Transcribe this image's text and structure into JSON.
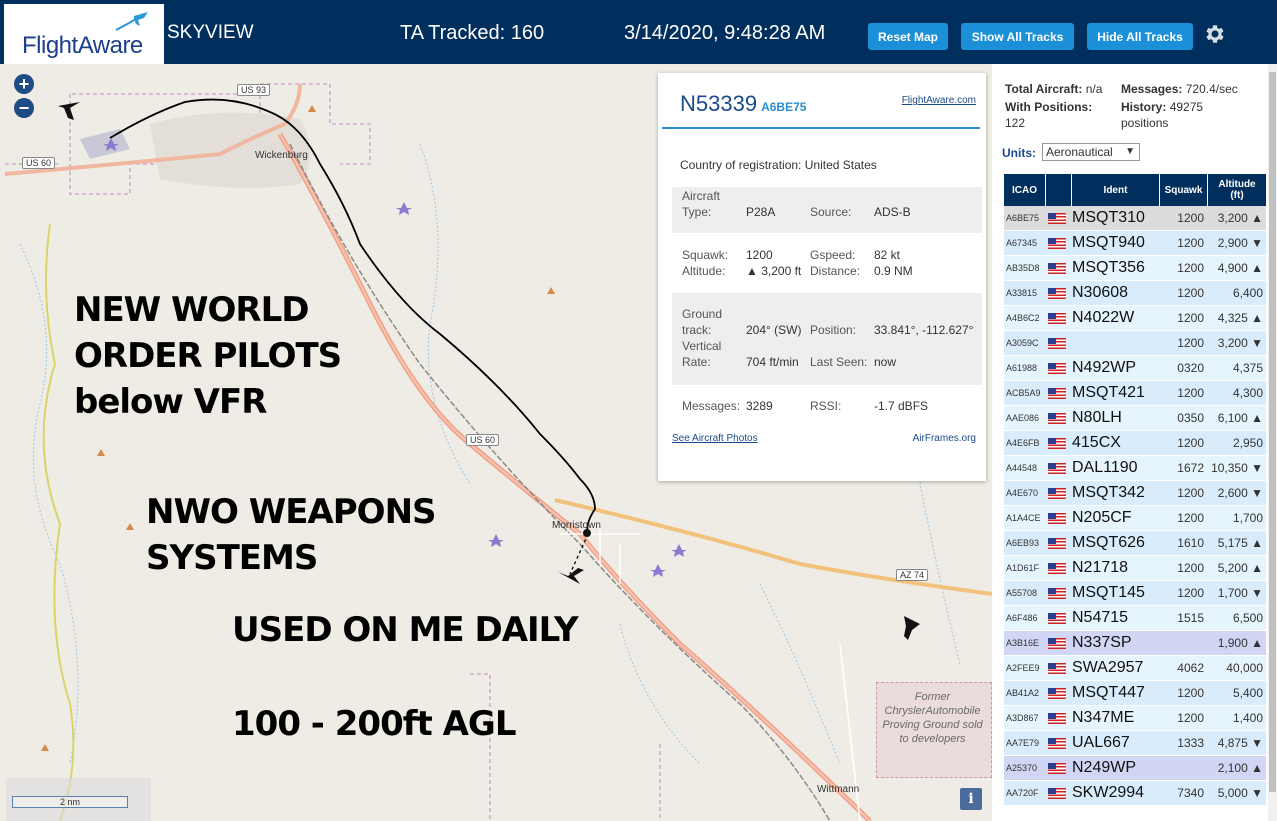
{
  "header": {
    "logo": "FlightAware",
    "app_name": "SKYVIEW",
    "tracked": "TA Tracked: 160",
    "datetime": "3/14/2020, 9:48:28 AM",
    "buttons": {
      "reset": "Reset Map",
      "show_all": "Show All Tracks",
      "hide_all": "Hide All Tracks"
    },
    "settings_icon": "gear-icon"
  },
  "map": {
    "zoom_in": "+",
    "zoom_out": "−",
    "scale": "2 nm",
    "info": "i",
    "labels": {
      "wickenburg": "Wickenburg",
      "morristown": "Morristown",
      "wittmann": "Wittmann",
      "us93": "US 93",
      "us60_a": "US 60",
      "us60_b": "US 60",
      "az74": "AZ 74",
      "chrysler": "Former ChryslerAutomobile Proving Ground sold to developers"
    },
    "overlay": {
      "line1": "NEW WORLD",
      "line2": "ORDER PILOTS",
      "line3": "below VFR",
      "line4": "NWO WEAPONS",
      "line5": "SYSTEMS",
      "line6": "USED ON ME DAILY",
      "line7": "100 - 200ft AGL"
    }
  },
  "popup": {
    "callsign": "N53339",
    "hex": "A6BE75",
    "fa_link": "FlightAware.com",
    "country_label": "Country of registration:",
    "country_value": "United States",
    "aircraft_type_label_1": "Aircraft",
    "aircraft_type_label_2": "Type:",
    "aircraft_type": "P28A",
    "source_label": "Source:",
    "source": "ADS-B",
    "squawk_label": "Squawk:",
    "squawk": "1200",
    "gspeed_label": "Gspeed:",
    "gspeed": "82 kt",
    "altitude_label": "Altitude:",
    "altitude": "▲ 3,200 ft",
    "distance_label": "Distance:",
    "distance": "0.9 NM",
    "ground_label_1": "Ground",
    "ground_label_2": "track:",
    "ground_track": "204° (SW)",
    "position_label": "Position:",
    "position": "33.841°, -112.627°",
    "vrate_label_1": "Vertical",
    "vrate_label_2": "Rate:",
    "vrate": "704 ft/min",
    "lastseen_label": "Last Seen:",
    "lastseen": "now",
    "messages_label": "Messages:",
    "messages": "3289",
    "rssi_label": "RSSI:",
    "rssi": "-1.7 dBFS",
    "photos_link": "See Aircraft Photos",
    "airframes_link": "AirFrames.org"
  },
  "panel": {
    "total_label": "Total Aircraft:",
    "total_value": "n/a",
    "messages_label": "Messages:",
    "messages_value": "720.4/sec",
    "withpos_label": "With Positions:",
    "withpos_value": "122",
    "history_label": "History:",
    "history_value": "49275",
    "history_unit": "positions",
    "units_label": "Units:",
    "units_value": "Aeronautical",
    "columns": {
      "icao": "ICAO",
      "ident": "Ident",
      "squawk": "Squawk",
      "alt1": "Altitude",
      "alt2": "(ft)"
    },
    "rows": [
      {
        "icao": "A6BE75",
        "ident": "MSQT310",
        "squawk": "1200",
        "alt": "3,200 ▲"
      },
      {
        "icao": "A67345",
        "ident": "MSQT940",
        "squawk": "1200",
        "alt": "2,900 ▼"
      },
      {
        "icao": "AB35D8",
        "ident": "MSQT356",
        "squawk": "1200",
        "alt": "4,900 ▲"
      },
      {
        "icao": "A33815",
        "ident": "N30608",
        "squawk": "1200",
        "alt": "6,400"
      },
      {
        "icao": "A4B6C2",
        "ident": "N4022W",
        "squawk": "1200",
        "alt": "4,325 ▲"
      },
      {
        "icao": "A3059C",
        "ident": "",
        "squawk": "1200",
        "alt": "3,200 ▼"
      },
      {
        "icao": "A61988",
        "ident": "N492WP",
        "squawk": "0320",
        "alt": "4,375"
      },
      {
        "icao": "ACB5A9",
        "ident": "MSQT421",
        "squawk": "1200",
        "alt": "4,300"
      },
      {
        "icao": "AAE086",
        "ident": "N80LH",
        "squawk": "0350",
        "alt": "6,100 ▲"
      },
      {
        "icao": "A4E6FB",
        "ident": "415CX",
        "squawk": "1200",
        "alt": "2,950"
      },
      {
        "icao": "A44548",
        "ident": "DAL1190",
        "squawk": "1672",
        "alt": "10,350 ▼"
      },
      {
        "icao": "A4E670",
        "ident": "MSQT342",
        "squawk": "1200",
        "alt": "2,600 ▼"
      },
      {
        "icao": "A1A4CE",
        "ident": "N205CF",
        "squawk": "1200",
        "alt": "1,700"
      },
      {
        "icao": "A6EB93",
        "ident": "MSQT626",
        "squawk": "1610",
        "alt": "5,175 ▲"
      },
      {
        "icao": "A1D61F",
        "ident": "N21718",
        "squawk": "1200",
        "alt": "5,200 ▲"
      },
      {
        "icao": "A55708",
        "ident": "MSQT145",
        "squawk": "1200",
        "alt": "1,700 ▼"
      },
      {
        "icao": "A6F486",
        "ident": "N54715",
        "squawk": "1515",
        "alt": "6,500"
      },
      {
        "icao": "A3B16E",
        "ident": "N337SP",
        "squawk": "",
        "alt": "1,900 ▲"
      },
      {
        "icao": "A2FEE9",
        "ident": "SWA2957",
        "squawk": "4062",
        "alt": "40,000"
      },
      {
        "icao": "AB41A2",
        "ident": "MSQT447",
        "squawk": "1200",
        "alt": "5,400"
      },
      {
        "icao": "A3D867",
        "ident": "N347ME",
        "squawk": "1200",
        "alt": "1,400"
      },
      {
        "icao": "AA7E79",
        "ident": "UAL667",
        "squawk": "1333",
        "alt": "4,875 ▼"
      },
      {
        "icao": "A25370",
        "ident": "N249WP",
        "squawk": "",
        "alt": "2,100 ▲"
      },
      {
        "icao": "AA720F",
        "ident": "SKW2994",
        "squawk": "7340",
        "alt": "5,000 ▼"
      }
    ]
  },
  "colors": {
    "header_bg": "#002f5d",
    "button_bg": "#1b8fd8",
    "row_bg": "#e6f4fd",
    "selected_row": "#dcdcdc",
    "highlight_row": "#d1d6f5"
  }
}
